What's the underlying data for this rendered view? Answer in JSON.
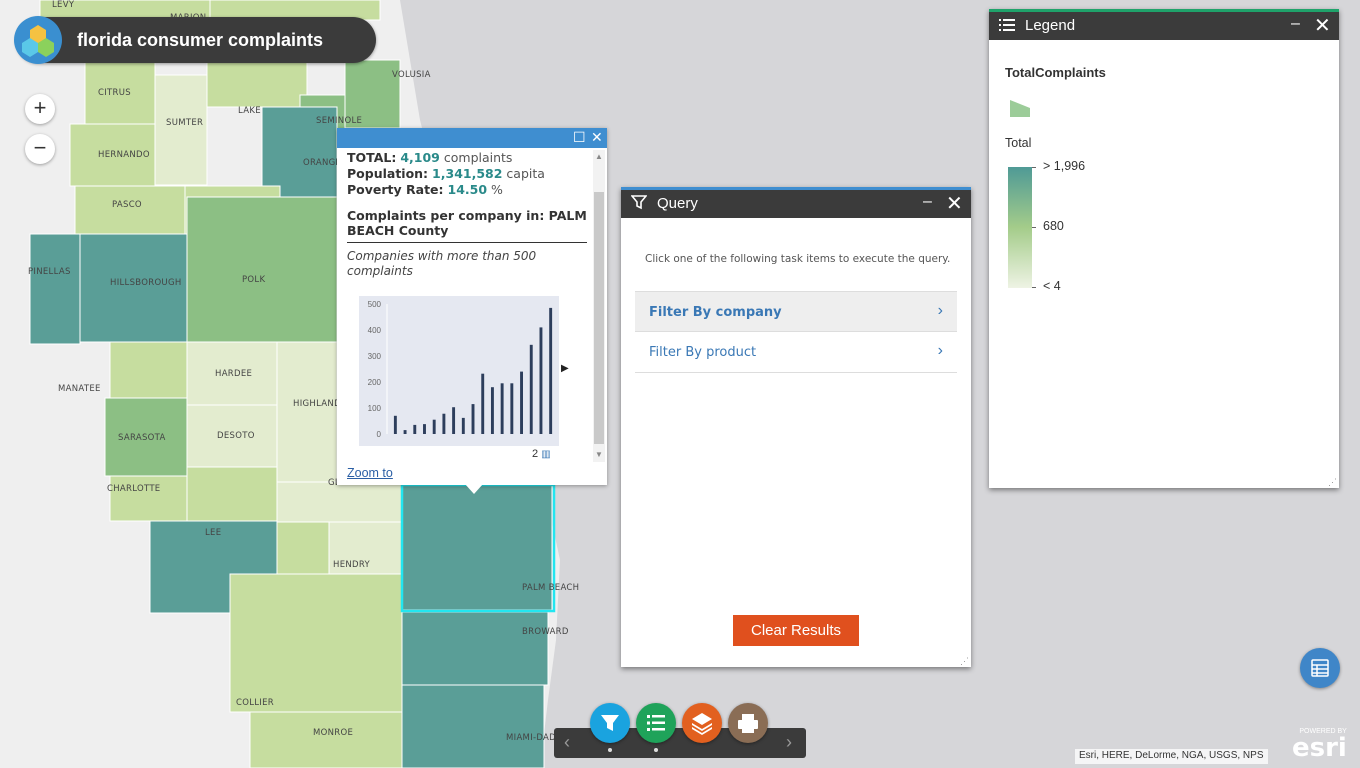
{
  "app": {
    "title": "florida consumer complaints"
  },
  "zoom": {
    "in_label": "+",
    "out_label": "−"
  },
  "map": {
    "county_labels": [
      "LEVY",
      "MARION",
      "VOLUSIA",
      "CITRUS",
      "SUMTER",
      "LAKE",
      "SEMINOLE",
      "ORANGE",
      "HERNANDO",
      "PASCO",
      "PINELLAS",
      "HILLSBOROUGH",
      "POLK",
      "MANATEE",
      "HARDEE",
      "HIGHLANDS",
      "SARASOTA",
      "DESOTO",
      "CHARLOTTE",
      "GLADES",
      "LEE",
      "HENDRY",
      "PALM BEACH",
      "BROWARD",
      "COLLIER",
      "MONROE",
      "MIAMI-DADE"
    ],
    "colors": {
      "dark": "#5a9e97",
      "mid": "#8cbf84",
      "light": "#c6dd9f",
      "pale": "#e3eccf",
      "selected_outline": "#22e6f0",
      "water": "#d6d6d9",
      "land": "#efefef"
    }
  },
  "popup": {
    "total_label": "TOTAL:",
    "total_value": "4,109",
    "total_unit": "complaints",
    "population_label": "Population:",
    "population_value": "1,341,582",
    "population_unit": "capita",
    "poverty_label": "Poverty Rate:",
    "poverty_value": "14.50",
    "poverty_unit": "%",
    "heading": "Complaints per company in: PALM BEACH County",
    "subheading": "Companies with more than 500 complaints",
    "page": "2",
    "zoom_to": "Zoom to"
  },
  "chart_data": {
    "type": "bar",
    "title": "",
    "xlabel": "",
    "ylabel": "",
    "ylim": [
      0,
      500
    ],
    "yticks": [
      0,
      100,
      200,
      300,
      400,
      500
    ],
    "values": [
      70,
      15,
      35,
      38,
      55,
      78,
      103,
      62,
      115,
      232,
      180,
      195,
      195,
      240,
      343,
      410,
      485
    ]
  },
  "query": {
    "title": "Query",
    "hint": "Click one of the following task items to execute the query.",
    "tasks": [
      {
        "label": "Filter By company"
      },
      {
        "label": "Filter By product"
      }
    ],
    "clear_label": "Clear Results"
  },
  "legend": {
    "title": "Legend",
    "layer": "TotalComplaints",
    "field": "Total",
    "max_label": "> 1,996",
    "mid_label": "680",
    "min_label": "< 4"
  },
  "toolbar": {
    "colors": {
      "query": "#1aa3df",
      "legend": "#1fa35a",
      "layers": "#e2601f",
      "print": "#8a6d55"
    }
  },
  "attribution": "Esri, HERE, DeLorme, NGA, USGS, NPS",
  "esri": {
    "powered_by": "POWERED BY",
    "wordmark": "esri"
  }
}
